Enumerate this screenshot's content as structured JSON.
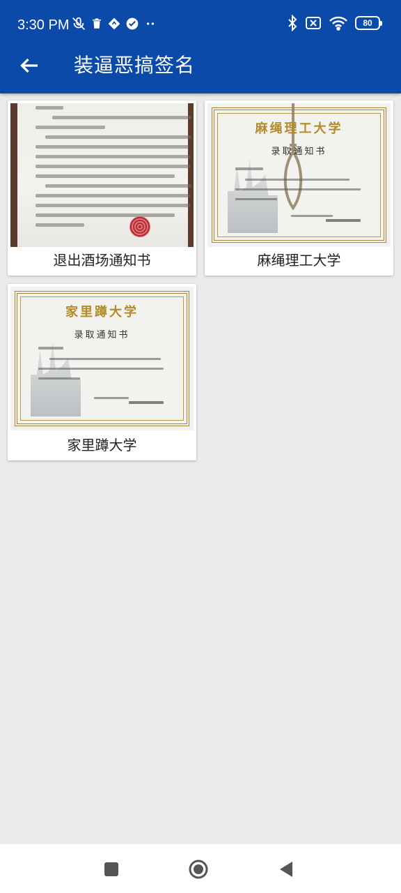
{
  "status_bar": {
    "time": "3:30 PM",
    "battery": "80",
    "left_icons": [
      "mic-off-icon",
      "trash-icon",
      "translate-icon",
      "check-circle-icon",
      "more-dots-icon"
    ],
    "right_icons": [
      "bluetooth-icon",
      "sim-off-icon",
      "wifi-icon",
      "battery-icon"
    ]
  },
  "app_bar": {
    "title": "装逼恶搞签名",
    "back_icon": "arrow-left-icon",
    "color": "#0b4aa9"
  },
  "cards": [
    {
      "label": "退出酒场通知书",
      "thumbnail": "letter"
    },
    {
      "label": "麻绳理工大学",
      "thumbnail": "certificate",
      "cert_title": "麻绳理工大学",
      "cert_sub": "录取通知书"
    },
    {
      "label": "家里蹲大学",
      "thumbnail": "certificate",
      "cert_title": "家里蹲大学",
      "cert_sub": "录取通知书"
    }
  ],
  "nav_bar": {
    "buttons": [
      "recents-square-icon",
      "home-circle-icon",
      "back-triangle-icon"
    ]
  }
}
